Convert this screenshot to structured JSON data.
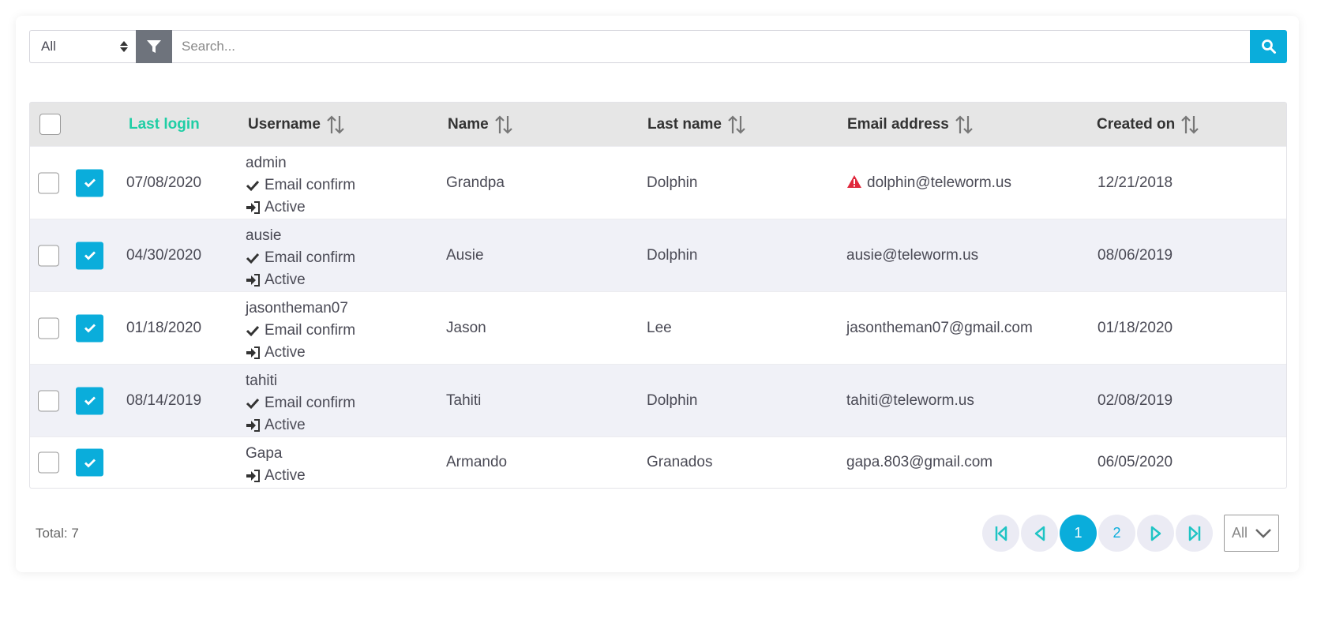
{
  "toolbar": {
    "status_select": "All",
    "search_placeholder": "Search..."
  },
  "columns": {
    "last_login": "Last login",
    "username": "Username",
    "name": "Name",
    "last_name": "Last name",
    "email": "Email address",
    "created_on": "Created on"
  },
  "rows": [
    {
      "last_login": "07/08/2020",
      "username": "admin",
      "email_confirm": "Email confirm",
      "status": "Active",
      "name": "Grandpa",
      "last_name": "Dolphin",
      "email": "dolphin@teleworm.us",
      "email_warning": true,
      "created_on": "12/21/2018"
    },
    {
      "last_login": "04/30/2020",
      "username": "ausie",
      "email_confirm": "Email confirm",
      "status": "Active",
      "name": "Ausie",
      "last_name": "Dolphin",
      "email": "ausie@teleworm.us",
      "created_on": "08/06/2019"
    },
    {
      "last_login": "01/18/2020",
      "username": "jasontheman07",
      "email_confirm": "Email confirm",
      "status": "Active",
      "name": "Jason",
      "last_name": "Lee",
      "email": "jasontheman07@gmail.com",
      "created_on": "01/18/2020"
    },
    {
      "last_login": "08/14/2019",
      "username": "tahiti",
      "email_confirm": "Email confirm",
      "status": "Active",
      "name": "Tahiti",
      "last_name": "Dolphin",
      "email": "tahiti@teleworm.us",
      "created_on": "02/08/2019"
    },
    {
      "last_login": "",
      "username": "Gapa",
      "status": "Active",
      "name": "Armando",
      "last_name": "Granados",
      "email": "gapa.803@gmail.com",
      "created_on": "06/05/2020"
    }
  ],
  "footer": {
    "total": "Total: 7",
    "pages": [
      "1",
      "2"
    ],
    "current_page": "1",
    "page_size": "All"
  },
  "colors": {
    "accent": "#0aaddb",
    "active_sort": "#1fcea5",
    "warning": "#e0283c"
  }
}
